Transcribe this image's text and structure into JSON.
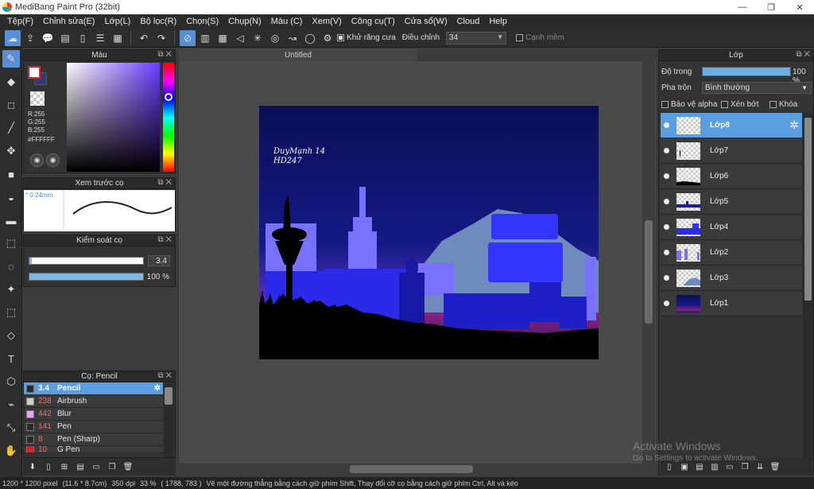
{
  "window": {
    "title": "MediBang Paint Pro (32bit)",
    "controls": [
      "—",
      "❐",
      "✕"
    ]
  },
  "menu": [
    "Tệp(F)",
    "Chỉnh sửa(E)",
    "Lớp(L)",
    "Bộ lọc(R)",
    "Chọn(S)",
    "Chụp(N)",
    "Màu (C)",
    "Xem(V)",
    "Công cụ(T)",
    "Cửa sổ(W)",
    "Cloud",
    "Help"
  ],
  "toolbar": {
    "antialias_label": "Khử răng cưa",
    "correction_label": "Điều chỉnh",
    "correction_value": "34",
    "soft_edge_label": "Cạnh mềm"
  },
  "color_panel": {
    "title": "Màu",
    "r": "R:255",
    "g": "G:255",
    "b": "B:255",
    "hex": "#FFFFFF",
    "foreground": "#ffffff",
    "background": "#2e3b78"
  },
  "preview_panel": {
    "title": "Xem trước cọ",
    "size": "* 0.24mm"
  },
  "brush_control": {
    "title": "Kiểm soát cọ",
    "size": "3.4",
    "opacity": "100 %",
    "size_fraction": 0.02,
    "opacity_fraction": 1.0
  },
  "brush_panel": {
    "title": "Cọ: Pencil",
    "items": [
      {
        "size": "3.4",
        "name": "Pencil",
        "color": "#2a2a2a",
        "selected": true
      },
      {
        "size": "238",
        "name": "Airbrush",
        "color": "#cfcfcf"
      },
      {
        "size": "442",
        "name": "Blur",
        "color": "#f0a0f0"
      },
      {
        "size": "141",
        "name": "Pen",
        "color": "#2a2a2a"
      },
      {
        "size": "8",
        "name": "Pen (Sharp)",
        "color": "#2a2a2a"
      },
      {
        "size": "10",
        "name": "G Pen",
        "color": "#e02020"
      }
    ]
  },
  "document": {
    "tab": "Untitled"
  },
  "canvas": {
    "signature_line1": "DuyMạnh 14",
    "signature_line2": "HD247"
  },
  "layer_panel": {
    "title": "Lớp",
    "opacity_label": "Độ trong",
    "opacity_value": "100 %",
    "blend_label": "Pha trộn",
    "blend_value": "Bình thường",
    "protect_alpha": "Bảo vệ alpha",
    "clipping": "Xén bớt",
    "lock": "Khóa",
    "layers": [
      {
        "name": "Lớp8",
        "selected": true
      },
      {
        "name": "Lớp7"
      },
      {
        "name": "Lớp6"
      },
      {
        "name": "Lớp5"
      },
      {
        "name": "Lớp4"
      },
      {
        "name": "Lớp2"
      },
      {
        "name": "Lớp3"
      },
      {
        "name": "Lớp1"
      }
    ]
  },
  "status": {
    "size": "1200 * 1200 pixel",
    "physical": "(11.6 * 8.7cm)",
    "dpi": "350 dpi",
    "zoom": "33 %",
    "coords": "( 1788, 783 )",
    "hint": "Vẽ một đường thẳng bằng cách giữ phím Shift, Thay đổi cỡ cọ bằng cách giữ phím Ctrl, Alt và kéo"
  },
  "watermark": {
    "line1": "Activate Windows",
    "line2": "Go to Settings to activate Windows."
  }
}
